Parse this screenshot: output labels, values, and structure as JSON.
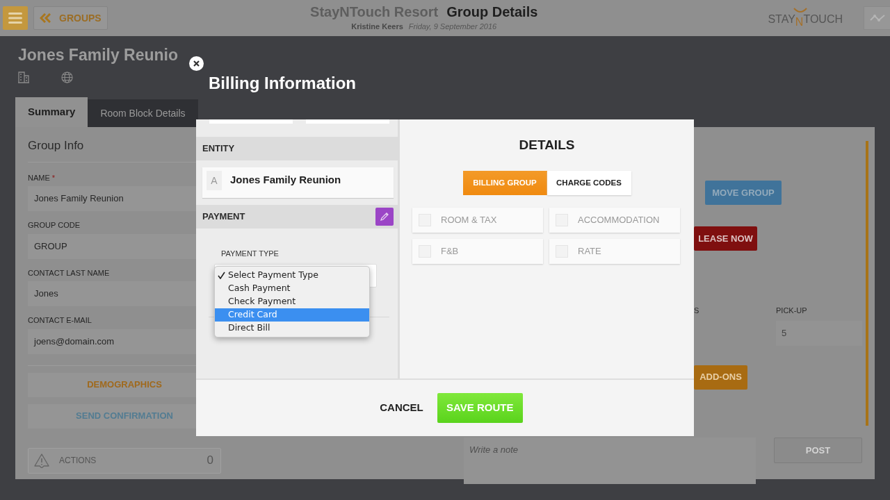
{
  "header": {
    "back_button": "GROUPS",
    "hotel": "StayNTouch Resort",
    "page_title": "Group Details",
    "user": "Kristine Keers",
    "date": "Friday, 9 September 2016",
    "logo": [
      "STAY",
      "N",
      "TOUCH"
    ]
  },
  "group_title": "Jones Family Reunio",
  "tabs": [
    {
      "label": "Summary",
      "selected": true
    },
    {
      "label": "Room Block Details",
      "selected": false
    }
  ],
  "group_info": {
    "heading": "Group Info",
    "fields": [
      {
        "label": "NAME",
        "required_mark": "*",
        "value": "Jones Family Reunion"
      },
      {
        "label": "GROUP CODE",
        "value": "GROUP"
      },
      {
        "label": "CONTACT LAST NAME",
        "value": "Jones"
      },
      {
        "label": "CONTACT E-MAIL",
        "value": "joens@domain.com"
      }
    ],
    "buttons": [
      {
        "label": "DEMOGRAPHICS",
        "kind": "accent"
      },
      {
        "label": "SEND CONFIRMATION",
        "kind": "info"
      }
    ],
    "actions": {
      "label": "ACTIONS",
      "count": "0"
    }
  },
  "room_block": {
    "move_button": "MOVE GROUP",
    "release_button": "LEASE NOW",
    "column_label": "S",
    "pickup": {
      "label": "PICK-UP",
      "value": "5"
    },
    "addons_button": "ADD-ONS",
    "note": {
      "placeholder": "Write a note"
    },
    "post_button": "POST"
  },
  "modal": {
    "title": "Billing Information",
    "entity": {
      "heading": "ENTITY",
      "initial": "A",
      "name": "Jones Family Reunion"
    },
    "payment": {
      "heading": "PAYMENT",
      "type_label": "PAYMENT TYPE",
      "options": [
        {
          "label": "Select Payment Type",
          "checked": true,
          "highlighted": false
        },
        {
          "label": "Cash Payment",
          "checked": false,
          "highlighted": false
        },
        {
          "label": "Check Payment",
          "checked": false,
          "highlighted": false
        },
        {
          "label": "Credit Card",
          "checked": false,
          "highlighted": true
        },
        {
          "label": "Direct Bill",
          "checked": false,
          "highlighted": false
        }
      ]
    },
    "details": {
      "heading": "DETAILS",
      "toggles": [
        {
          "label": "BILLING GROUP",
          "selected": true
        },
        {
          "label": "CHARGE CODES",
          "selected": false
        }
      ],
      "charge_options": [
        {
          "label": "ROOM & TAX",
          "checked": false
        },
        {
          "label": "ACCOMMODATION",
          "checked": false
        },
        {
          "label": "F&B",
          "checked": false
        },
        {
          "label": "RATE",
          "checked": false
        }
      ]
    },
    "footer": {
      "cancel": "CANCEL",
      "save": "SAVE ROUTE"
    }
  }
}
